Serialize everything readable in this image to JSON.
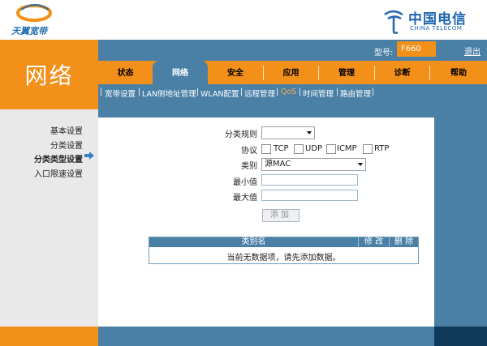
{
  "header": {
    "brand_left": "天翼宽带",
    "brand_right_cn": "中国电信",
    "brand_right_en": "CHINA TELECOM",
    "model_label": "型号:",
    "model_value": "F660",
    "logout": "退出"
  },
  "section_title": "网络",
  "tabs": [
    "状态",
    "网络",
    "安全",
    "应用",
    "管理",
    "诊断",
    "帮助"
  ],
  "active_tab": "网络",
  "subnav": [
    "宽带设置",
    "LAN侧地址管理",
    "WLAN配置",
    "远程管理",
    "QoS",
    "时间管理",
    "路由管理"
  ],
  "active_subnav": "QoS",
  "sidebar": [
    "基本设置",
    "分类设置",
    "分类类型设置",
    "入口限速设置"
  ],
  "active_sidebar": "分类类型设置",
  "form": {
    "rule_label": "分类规则",
    "rule_value": "",
    "protocol_label": "协议",
    "protocols": [
      "TCP",
      "UDP",
      "ICMP",
      "RTP"
    ],
    "type_label": "类别",
    "type_value": "源MAC",
    "min_label": "最小值",
    "min_value": "",
    "max_label": "最大值",
    "max_value": "",
    "add_button": "添加"
  },
  "table": {
    "headers": [
      "类别名",
      "修 改",
      "删 除"
    ],
    "empty_message": "当前无数据项，请先添加数据。"
  },
  "colors": {
    "orange": "#f39019",
    "blue": "#4a7fa6",
    "dark_blue": "#103a5a",
    "active_link": "#f5b14d"
  },
  "icons": {
    "sidebar_active": "arrow-right-icon",
    "dropdown": "caret-down-icon"
  }
}
